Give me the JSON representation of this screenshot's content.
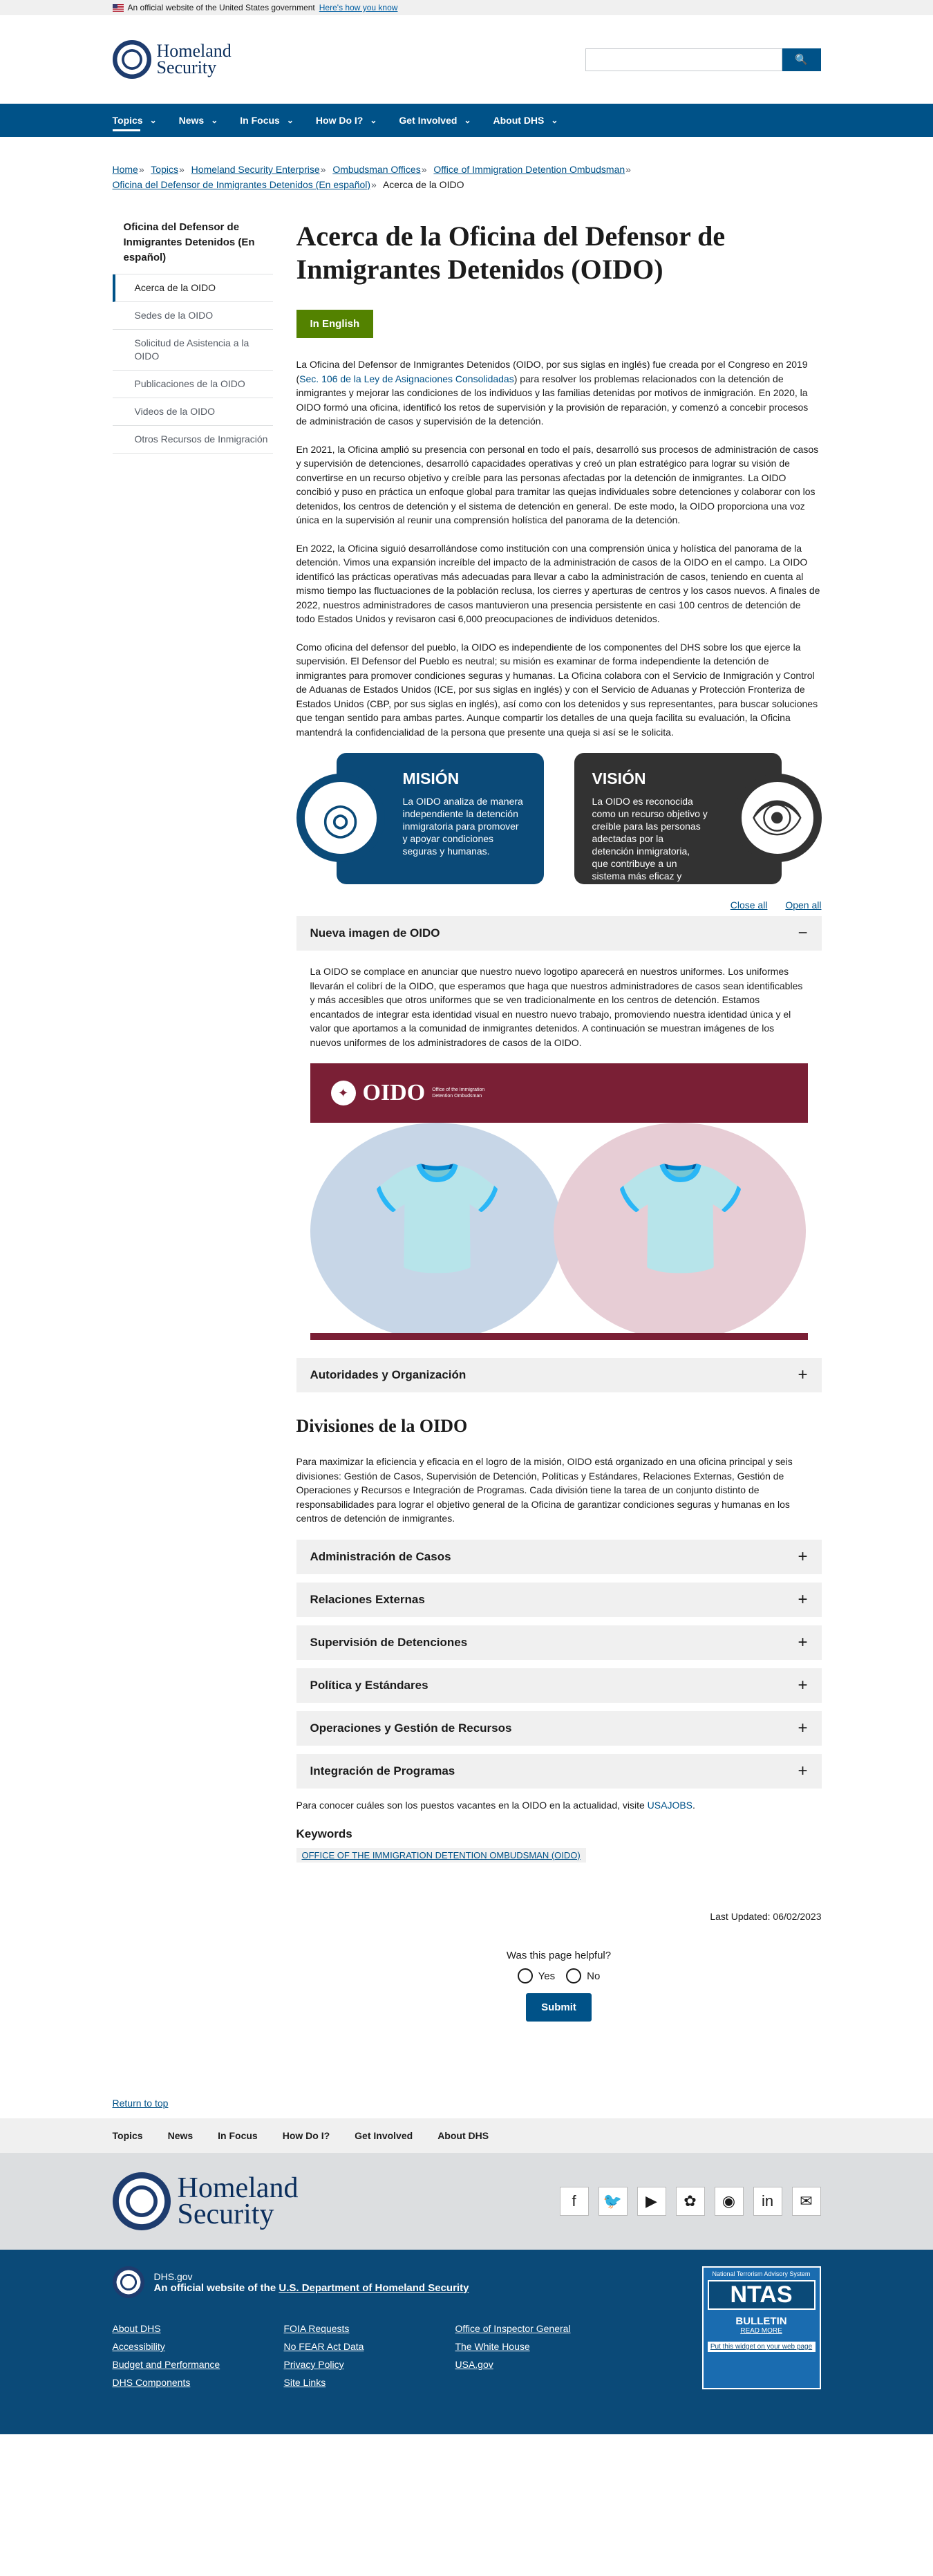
{
  "banner": {
    "text": "An official website of the United States government",
    "link": "Here's how you know"
  },
  "header": {
    "logo_line1": "Homeland",
    "logo_line2": "Security",
    "search_placeholder": "",
    "search_button": "🔍"
  },
  "nav": [
    {
      "label": "Topics",
      "chev": "⌄"
    },
    {
      "label": "News",
      "chev": "⌄"
    },
    {
      "label": "In Focus",
      "chev": "⌄"
    },
    {
      "label": "How Do I?",
      "chev": "⌄"
    },
    {
      "label": "Get Involved",
      "chev": "⌄"
    },
    {
      "label": "About DHS",
      "chev": "⌄"
    }
  ],
  "breadcrumb": {
    "items": [
      "Home",
      "Topics",
      "Homeland Security Enterprise",
      "Ombudsman Offices",
      "Office of Immigration Detention Ombudsman",
      "Oficina del Defensor de Inmigrantes Detenidos (En español)"
    ],
    "current": "Acerca de la OIDO"
  },
  "sidenav": {
    "title": "Oficina del Defensor de Inmigrantes Detenidos (En español)",
    "items": [
      "Acerca de la OIDO",
      "Sedes de la OIDO",
      "Solicitud de Asistencia a la OIDO",
      "Publicaciones de la OIDO",
      "Videos de la OIDO",
      "Otros Recursos de Inmigración"
    ]
  },
  "main": {
    "title": "Acerca de la Oficina del Defensor de Inmigrantes Detenidos (OIDO)",
    "english_button": "In English",
    "p1_a": "La Oficina del Defensor de Inmigrantes Detenidos (OIDO, por sus siglas en inglés) fue creada por el Congreso en 2019 (",
    "p1_link": "Sec. 106 de la Ley de Asignaciones Consolidadas",
    "p1_b": ") para resolver los problemas relacionados con la detención de inmigrantes y mejorar las condiciones de los individuos y las familias detenidas por motivos de inmigración. En 2020, la OIDO formó una oficina, identificó los retos de supervisión y la provisión de reparación, y comenzó a concebir procesos de administración de casos y supervisión de la detención.",
    "p2": "En 2021, la Oficina amplió su presencia con personal en todo el país, desarrolló sus procesos de administración de casos y supervisión de detenciones, desarrolló capacidades operativas y creó un plan estratégico para lograr su visión de convertirse en un recurso objetivo y creíble para las personas afectadas por la detención de inmigrantes. La OIDO concibió y puso en práctica un enfoque global para tramitar las quejas individuales sobre detenciones y colaborar con los detenidos, los centros de detención y el sistema de detención en general. De este modo, la OIDO proporciona una voz única en la supervisión al reunir una comprensión holística del panorama de la detención.",
    "p3": "En 2022, la Oficina siguió desarrollándose como institución con una comprensión única y holística del panorama de la detención. Vimos una expansión increíble del impacto de la administración de casos de la OIDO en el campo. La OIDO identificó las prácticas operativas más adecuadas para llevar a cabo la administración de casos, teniendo en cuenta al mismo tiempo las fluctuaciones de la población reclusa, los cierres y aperturas de centros y los casos nuevos. A finales de 2022, nuestros administradores de casos mantuvieron una presencia persistente en casi 100 centros de detención de todo Estados Unidos y revisaron casi 6,000 preocupaciones de individuos detenidos.",
    "p4": "Como oficina del defensor del pueblo, la OIDO es independiente de los componentes del DHS sobre los que ejerce la supervisión. El Defensor del Pueblo es neutral; su misión es examinar de forma independiente la detención de inmigrantes para promover condiciones seguras y humanas. La Oficina colabora con el Servicio de Inmigración y Control de Aduanas de Estados Unidos (ICE, por sus siglas en inglés) y con el Servicio de Aduanas y Protección Fronteriza de Estados Unidos (CBP, por sus siglas en inglés), así como con los detenidos y sus representantes, para buscar soluciones que tengan sentido para ambas partes. Aunque compartir los detalles de una queja facilita su evaluación, la Oficina mantendrá la confidencialidad de la persona que presente una queja si así se le solicita.",
    "mision": {
      "title": "MISIÓN",
      "body": "La OIDO analiza de manera independiente la detención inmigratoria para promover y apoyar condiciones seguras y humanas.",
      "icon": "◎"
    },
    "vision": {
      "title": "VISIÓN",
      "body": "La OIDO es reconocida como un recurso objetivo y creíble para las personas adectadas por la detención inmigratoria, que contribuye a un sistema más eficaz y humano.",
      "icon": "👁"
    },
    "close_all": "Close all",
    "open_all": "Open all",
    "acc1": {
      "title": "Nueva imagen de OIDO",
      "toggle": "−",
      "body": "La OIDO se complace en anunciar que nuestro nuevo logotipo aparecerá en nuestros uniformes. Los uniformes llevarán el colibrí de la OIDO, que esperamos que haga que nuestros administradores de casos sean identificables y más accesibles que otros uniformes que se ven tradicionalmente en los centros de detención. Estamos encantados de integrar esta identidad visual en nuestro nuevo trabajo, promoviendo nuestra identidad única y el valor que aportamos a la comunidad de inmigrantes detenidos. A continuación se muestran imágenes de los nuevos uniformes de los administradores de casos de la OIDO."
    },
    "uniform": {
      "brand": "OIDO",
      "sub": "Office of the Immigration Detention Ombudsman"
    },
    "acc2": {
      "title": "Autoridades y Organización",
      "toggle": "+"
    },
    "divisions_title": "Divisiones de la OIDO",
    "divisions_intro": "Para maximizar la eficiencia y eficacia en el logro de la misión, OIDO está organizado en una oficina principal y seis divisiones: Gestión de Casos, Supervisión de Detención, Políticas y Estándares, Relaciones Externas, Gestión de Operaciones y Recursos e Integración de Programas. Cada división tiene la tarea de un conjunto distinto de responsabilidades para lograr el objetivo general de la Oficina de garantizar condiciones seguras y humanas en los centros de detención de inmigrantes.",
    "divisions": [
      "Administración de Casos",
      "Relaciones Externas",
      "Supervisión de Detenciones",
      "Política y Estándares",
      "Operaciones y Gestión de Recursos",
      "Integración de Programas"
    ],
    "jobs_text": "Para conocer cuáles son los puestos vacantes en la OIDO en la actualidad, visite ",
    "jobs_link": "USAJOBS",
    "keywords_title": "Keywords",
    "keyword": "OFFICE OF THE IMMIGRATION DETENTION OMBUDSMAN (OIDO)",
    "updated": "Last Updated: 06/02/2023",
    "helpful": "Was this page helpful?",
    "yes": "Yes",
    "no": "No",
    "submit": "Submit",
    "return": "Return to top"
  },
  "footer": {
    "nav": [
      "Topics",
      "News",
      "In Focus",
      "How Do I?",
      "Get Involved",
      "About DHS"
    ],
    "logo_line1": "Homeland",
    "logo_line2": "Security",
    "social": [
      "f",
      "🐦",
      "▶",
      "✿",
      "◉",
      "in",
      "✉"
    ],
    "site": "DHS.gov",
    "official_a": "An official website of the ",
    "official_link": "U.S. Department of Homeland Security",
    "links": [
      "About DHS",
      "FOIA Requests",
      "Office of Inspector General",
      "Accessibility",
      "No FEAR Act Data",
      "The White House",
      "Budget and Performance",
      "Privacy Policy",
      "USA.gov",
      "DHS Components",
      "Site Links"
    ],
    "ntas": {
      "top": "National Terrorism Advisory System",
      "big": "NTAS",
      "bulletin": "BULLETIN",
      "read": "READ MORE",
      "put": "Put this widget on your web page"
    }
  }
}
